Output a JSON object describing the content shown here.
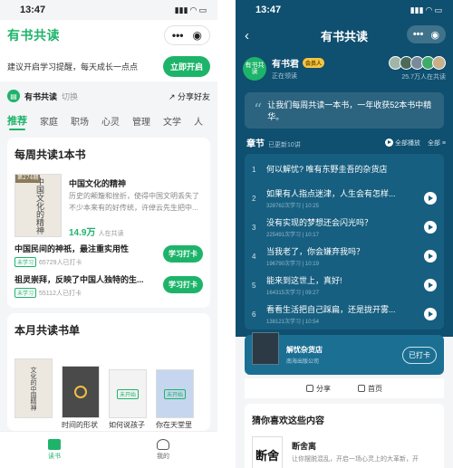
{
  "left": {
    "status": {
      "time": "13:47"
    },
    "logo": "有书共读",
    "capsule": {
      "more": "•••",
      "target": "◉"
    },
    "remind": {
      "text": "建议开启学习提醒，每天成长一点点",
      "button": "立即开启"
    },
    "books_bar": {
      "name": "有书共读",
      "switch": "切换",
      "share": "分享好友"
    },
    "tabs": [
      "推荐",
      "家庭",
      "职场",
      "心灵",
      "管理",
      "文学",
      "人"
    ],
    "weekly": {
      "title": "每周共读1本书",
      "cover_tag": "第274期",
      "cover_text": "中国文化的精神",
      "book_title": "中国文化的精神",
      "book_desc": "历史的颠簸和挫折，使得中国文明丢失了不少本来有的好传统，许倬云先生把中...",
      "count": "14.9万",
      "count_suffix": "人在共读",
      "items": [
        {
          "title": "中国民间的神祇，最注重实用性",
          "badge": "未学习",
          "stat": "65729人已打卡",
          "button": "学习打卡"
        },
        {
          "title": "祖灵崇拜，反映了中国人独特的生...",
          "badge": "未学习",
          "stat": "55112人已打卡",
          "button": "学习打卡"
        }
      ]
    },
    "monthly": {
      "title": "本月共读书单",
      "books": [
        {
          "cover": "文化的中国精神",
          "label": ""
        },
        {
          "cover": "",
          "label": "时间的形状"
        },
        {
          "cover": "",
          "label": "如何说孩子"
        },
        {
          "cover": "",
          "label": "你在天堂里"
        }
      ],
      "badges": [
        "未开始",
        "未开始"
      ]
    },
    "nav": [
      {
        "label": "读书",
        "icon": "book-icon"
      },
      {
        "label": "我的",
        "icon": "user-icon"
      }
    ]
  },
  "right": {
    "status": {
      "time": "13:47"
    },
    "title": "有书共读",
    "back": "‹",
    "capsule": {
      "more": "•••",
      "target": "◉"
    },
    "host": {
      "avatar": "有书共读",
      "name": "有书君",
      "vip": "会员人",
      "sub": "正在领读"
    },
    "listeners": "25.7万人在共读",
    "quote": "让我们每周共读一本书，一年收获52本书中精华。",
    "chapters": {
      "title": "章节",
      "updated": "已更新10讲",
      "play_all": "全部播放",
      "all": "全部",
      "items": [
        {
          "num": "1",
          "title": "何以解忧? 唯有东野圭吾的杂货店",
          "meta": "",
          "playing": false
        },
        {
          "num": "2",
          "title": "如果有人指点迷津，人生会有怎样...",
          "meta": "328762次学习 | 10:25",
          "playing": true
        },
        {
          "num": "3",
          "title": "没有实现的梦想还会闪光吗？",
          "meta": "225491次学习 | 10:17",
          "playing": true
        },
        {
          "num": "4",
          "title": "当我老了，你会嫌弃我吗？",
          "meta": "196790次学习 | 10:19",
          "playing": true
        },
        {
          "num": "5",
          "title": "能来到这世上，真好!",
          "meta": "164315次学习 | 09:27",
          "playing": true
        },
        {
          "num": "6",
          "title": "看看生活把自己踩扁，还是拢开雾...",
          "meta": "138121次学习 | 10:54",
          "playing": true
        }
      ]
    },
    "done_card": {
      "title": "解忧杂货店",
      "publisher": "南海出版公司",
      "button": "已打卡"
    },
    "share": {
      "share": "分享",
      "home": "首页"
    },
    "like": {
      "title": "猜你喜欢这些内容",
      "cover": "断舍",
      "name": "断舍离",
      "desc": "让你摆脱混乱，开启一场心灵上的大革新，开"
    },
    "colors": {
      "accent": "#1db46a",
      "header_bg": "#0f4f6f"
    }
  }
}
